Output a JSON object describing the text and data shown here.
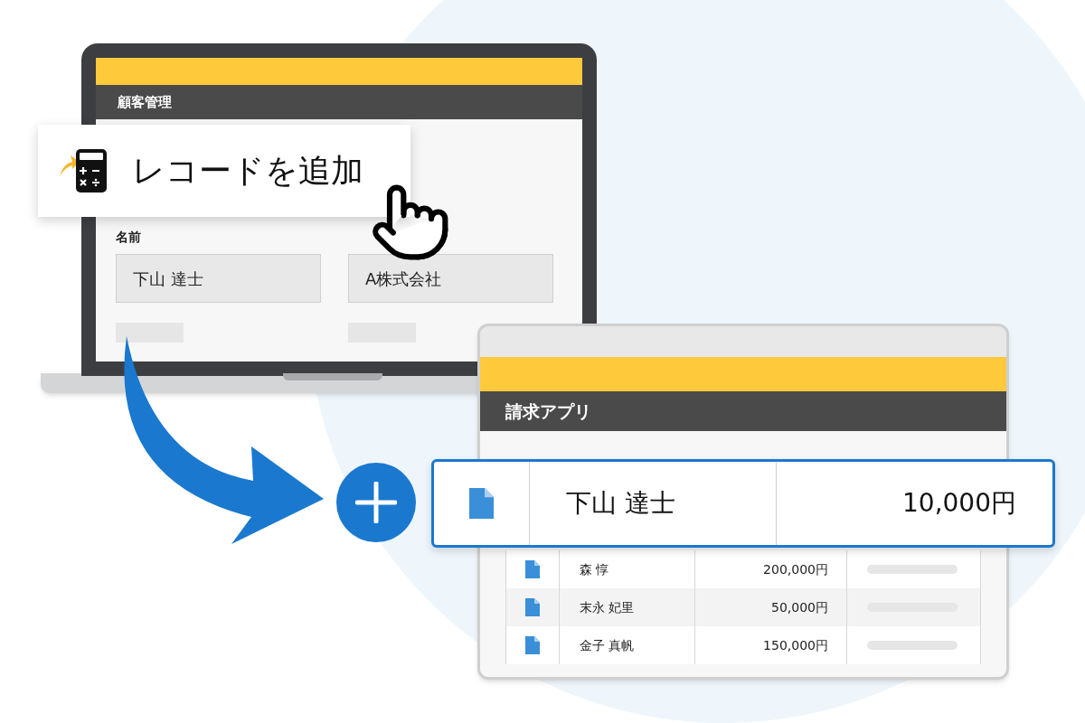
{
  "laptop_app": {
    "title": "顧客管理",
    "field_label": "名前",
    "fields": [
      {
        "value": "下山 達士"
      },
      {
        "value": "A株式会社"
      }
    ]
  },
  "add_record_button": {
    "label": "レコードを追加"
  },
  "billing_app": {
    "title": "請求アプリ",
    "new_record": {
      "name": "下山 達士",
      "amount": "10,000円"
    },
    "rows": [
      {
        "name": "森 惇",
        "amount": "200,000円"
      },
      {
        "name": "末永 妃里",
        "amount": "50,000円"
      },
      {
        "name": "金子 真帆",
        "amount": "150,000円"
      }
    ]
  }
}
